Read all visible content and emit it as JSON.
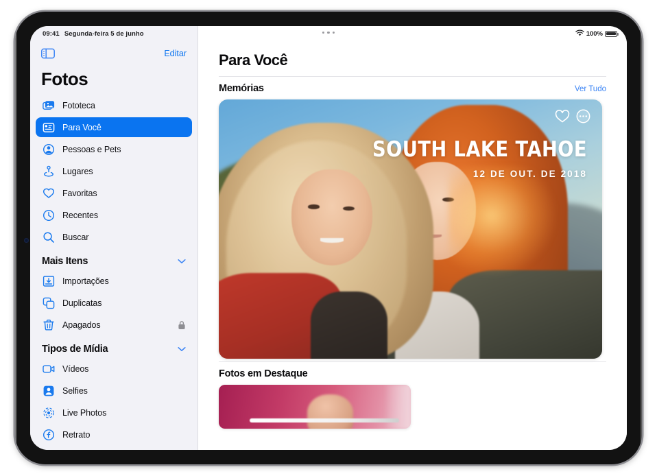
{
  "status_bar": {
    "time": "09:41",
    "date": "Segunda-feira 5 de junho",
    "battery_percent": "100%",
    "wifi_icon": "wifi-icon",
    "battery_icon": "battery-full-icon"
  },
  "sidebar": {
    "toggle_icon": "sidebar-toggle-icon",
    "edit_label": "Editar",
    "title": "Fotos",
    "primary_items": [
      {
        "label": "Fototeca",
        "icon": "photos-library-icon",
        "selected": false
      },
      {
        "label": "Para Você",
        "icon": "for-you-icon",
        "selected": true
      },
      {
        "label": "Pessoas e Pets",
        "icon": "people-pets-icon",
        "selected": false
      },
      {
        "label": "Lugares",
        "icon": "places-pin-icon",
        "selected": false
      },
      {
        "label": "Favoritas",
        "icon": "heart-icon",
        "selected": false
      },
      {
        "label": "Recentes",
        "icon": "clock-icon",
        "selected": false
      },
      {
        "label": "Buscar",
        "icon": "search-icon",
        "selected": false
      }
    ],
    "more_items_section": {
      "title": "Mais Itens",
      "chevron_icon": "chevron-down-icon",
      "items": [
        {
          "label": "Importações",
          "icon": "import-icon",
          "trailing_icon": ""
        },
        {
          "label": "Duplicatas",
          "icon": "duplicates-icon",
          "trailing_icon": ""
        },
        {
          "label": "Apagados",
          "icon": "trash-icon",
          "trailing_icon": "lock-icon"
        }
      ]
    },
    "media_types_section": {
      "title": "Tipos de Mídia",
      "chevron_icon": "chevron-down-icon",
      "items": [
        {
          "label": "Vídeos",
          "icon": "video-camera-icon"
        },
        {
          "label": "Selfies",
          "icon": "selfie-icon"
        },
        {
          "label": "Live Photos",
          "icon": "live-photo-icon"
        },
        {
          "label": "Retrato",
          "icon": "portrait-icon"
        }
      ]
    }
  },
  "content": {
    "page_title": "Para Você",
    "memories": {
      "section_title": "Memórias",
      "see_all_label": "Ver Tudo",
      "card": {
        "title": "SOUTH LAKE TAHOE",
        "date": "12 DE OUT. DE 2018",
        "favorite_icon": "heart-outline-icon",
        "more_icon": "ellipsis-circle-icon"
      }
    },
    "featured": {
      "section_title": "Fotos em Destaque"
    }
  },
  "multitask_icon": "multitask-dots-icon",
  "colors": {
    "accent": "#0A74F0",
    "link": "#3B84F5",
    "sidebar_bg": "#F2F2F7",
    "content_bg": "#FFFFFF",
    "text_primary": "#0B0B0D",
    "frame": "#121212"
  }
}
